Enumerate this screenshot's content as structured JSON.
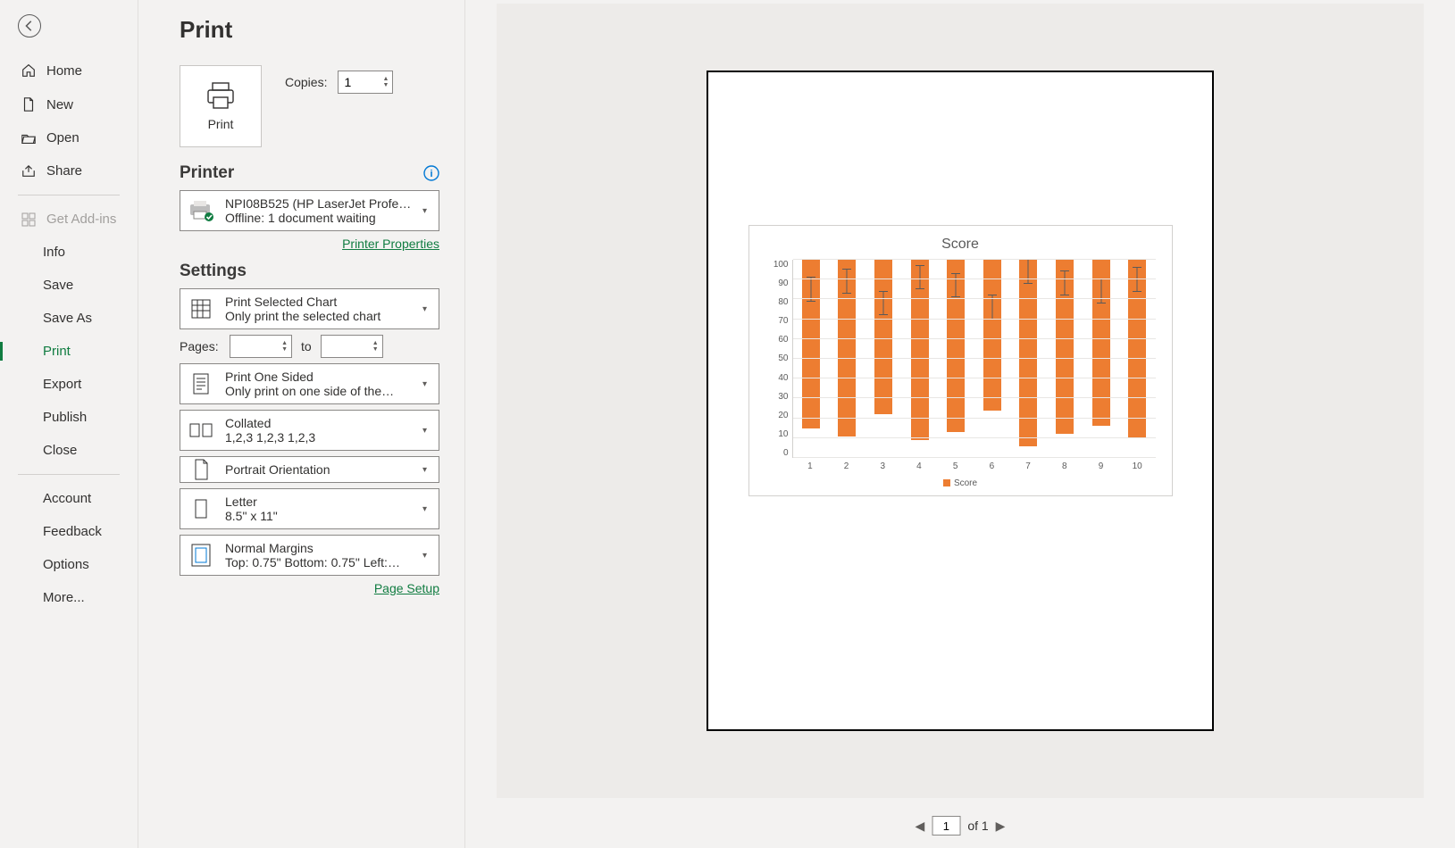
{
  "nav": {
    "home": "Home",
    "new": "New",
    "open": "Open",
    "share": "Share",
    "getaddins": "Get Add-ins",
    "info": "Info",
    "save": "Save",
    "saveas": "Save As",
    "print": "Print",
    "export": "Export",
    "publish": "Publish",
    "close": "Close",
    "account": "Account",
    "feedback": "Feedback",
    "options": "Options",
    "more": "More..."
  },
  "page": {
    "title": "Print",
    "printBtn": "Print",
    "copiesLabel": "Copies:",
    "copiesValue": "1",
    "printerHead": "Printer",
    "printerName": "NPI08B525 (HP LaserJet Profe…",
    "printerStatus": "Offline: 1 document waiting",
    "printerProps": "Printer Properties",
    "settingsHead": "Settings",
    "whatL1": "Print Selected Chart",
    "whatL2": "Only print the selected chart",
    "pagesLabel": "Pages:",
    "toLabel": "to",
    "sidedL1": "Print One Sided",
    "sidedL2": "Only print on one side of the…",
    "collatedL1": "Collated",
    "collatedL2": "1,2,3    1,2,3    1,2,3",
    "orientL1": "Portrait Orientation",
    "paperL1": "Letter",
    "paperL2": "8.5\" x 11\"",
    "marginsL1": "Normal Margins",
    "marginsL2": "Top: 0.75\" Bottom: 0.75\" Left:…",
    "pageSetup": "Page Setup"
  },
  "preview": {
    "current": "1",
    "of": "of 1"
  },
  "chart_data": {
    "type": "bar",
    "title": "Score",
    "legend": "Score",
    "categories": [
      "1",
      "2",
      "3",
      "4",
      "5",
      "6",
      "7",
      "8",
      "9",
      "10"
    ],
    "values": [
      85,
      89,
      78,
      91,
      87,
      76,
      94,
      88,
      84,
      90
    ],
    "error": 6,
    "ylim": [
      0,
      100
    ],
    "yticks": [
      0,
      10,
      20,
      30,
      40,
      50,
      60,
      70,
      80,
      90,
      100
    ],
    "color": "#ed7d31"
  }
}
